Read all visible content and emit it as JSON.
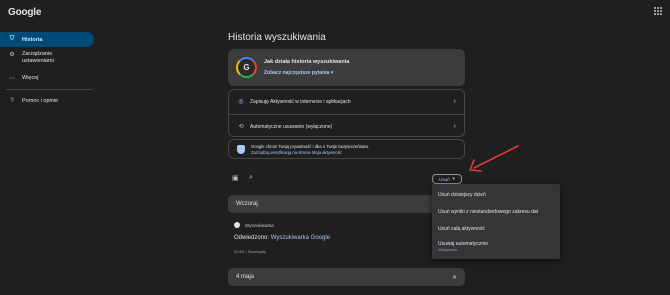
{
  "header": {
    "logo": "Google"
  },
  "sidebar": {
    "items": [
      {
        "label": "Historia",
        "icon": "shield-clock-icon",
        "active": true
      },
      {
        "label": "Zarządzanie ustawieniami",
        "icon": "gear-icon"
      },
      {
        "label": "Więcej",
        "icon": "more-icon"
      },
      {
        "label": "Pomoc i opinie",
        "icon": "help-icon"
      }
    ],
    "manage_line1": "Zarządzanie",
    "manage_line2": "ustawieniami"
  },
  "main": {
    "title": "Historia wyszukiwania",
    "promo": {
      "title": "Jak działa historia wyszukiwania",
      "link": "Zobacz najczęstsze pytania"
    },
    "settings": [
      {
        "label": "Zapisuję Aktywność w internecie i aplikacjach"
      },
      {
        "label": "Automatyczne usuwanie (wyłączone)"
      }
    ],
    "privacy": {
      "line1": "Google chroni Twoją prywatność i dba o Twoje bezpieczeństwo.",
      "line2": "Zarządzaj weryfikacją na stronie Moja aktywność"
    },
    "delete_button": "Usuń",
    "delete_menu": [
      {
        "label": "Usuń dzisiejszy dzień"
      },
      {
        "label": "Usuń wyniki z niestandardowego zakresu dat"
      },
      {
        "label": "Usuń całą aktywność"
      },
      {
        "label": "Usuwaj automatycznie",
        "sub": "Wyłączone"
      }
    ],
    "days": [
      {
        "label": "Wczoraj",
        "entry": {
          "source": "Wyszukiwarka",
          "prefix": "Odwiedzono:",
          "link": "Wyszukiwarka Google",
          "meta": "20:55 • Szczegóły"
        }
      },
      {
        "label": "4 maja"
      }
    ]
  },
  "colors": {
    "background": "#1f1f1f",
    "accent": "#a8c7fa",
    "active_nav": "#004a77",
    "arrow": "#e53935"
  }
}
